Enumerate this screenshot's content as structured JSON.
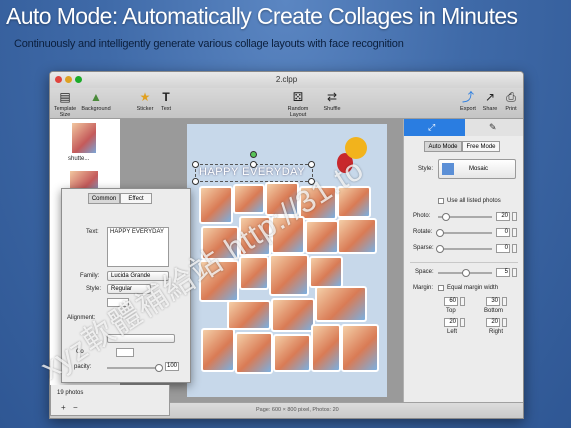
{
  "headline": "Auto Mode: Automatically Create Collages in Minutes",
  "subline": "Continuously and intelligently generate various collage layouts with face recognition",
  "window": {
    "title": "2.clpp"
  },
  "toolbar": {
    "template_size": "Template Size",
    "background": "Background",
    "sticker": "Sticker",
    "text": "Text",
    "random_layout": "Random Layout",
    "shuffle": "Shuffle",
    "export": "Export",
    "share": "Share",
    "print": "Print"
  },
  "thumbs": {
    "item1_label": "shutte..."
  },
  "poster": {
    "caption": "HAPPY EVERYDAY"
  },
  "text_panel": {
    "tab_common": "Common",
    "tab_effect": "Effect",
    "text_label": "Text:",
    "text_value": "HAPPY EVERYDAY",
    "family_label": "Family:",
    "family_value": "Lucida Grande",
    "style_label": "Style:",
    "style_value": "Regular",
    "alignment_label": "Alignment:",
    "color_label": "Co",
    "opacity_label": "pacity:",
    "opacity_value": "100"
  },
  "right_panel": {
    "tab_auto": "Auto Mode",
    "tab_free": "Free Mode",
    "style_label": "Style:",
    "style_value": "Mosaic",
    "use_all_label": "Use all listed photos",
    "photo_label": "Photo:",
    "photo_value": "20",
    "rotate_label": "Rotate:",
    "rotate_value": "0",
    "sparse_label": "Sparse:",
    "sparse_value": "0",
    "space_label": "Space:",
    "space_value": "5",
    "margin_label": "Margin:",
    "equal_margin_label": "Equal margin width",
    "top_value": "60",
    "bottom_value": "30",
    "top_label": "Top",
    "bottom_label": "Bottom",
    "left_value": "20",
    "right_value": "20",
    "left_label": "Left",
    "right_label": "Right"
  },
  "status": {
    "photo_count": "19 photos",
    "page_info": "Page: 600 × 800 pixel, Photos: 20",
    "add": "+",
    "remove": "−"
  },
  "watermark": "xyz軟體補給站 http://31.to",
  "colors": {
    "accent_tab": "#2a7de1",
    "balloon_sun": "#f2b31c",
    "balloon_red": "#c8282c"
  },
  "icons": [
    "template-icon",
    "background-icon",
    "sticker-icon",
    "text-icon",
    "random-layout-icon",
    "shuffle-icon",
    "export-icon",
    "share-icon",
    "print-icon"
  ]
}
